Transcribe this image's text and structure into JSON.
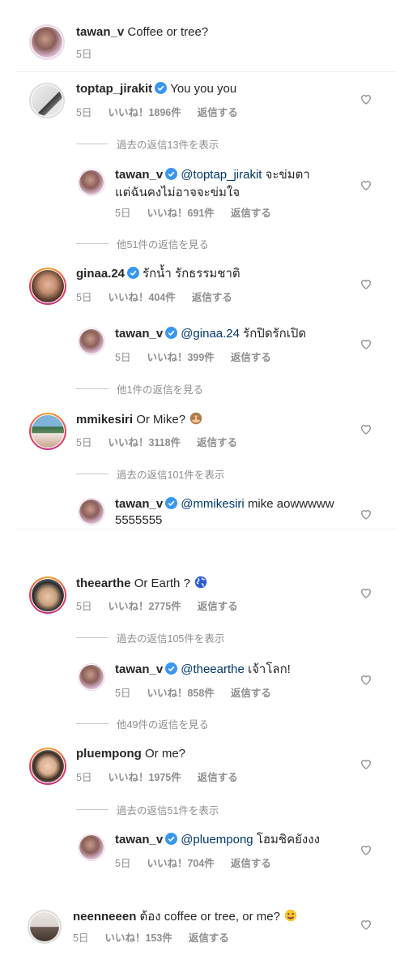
{
  "header_comment": {
    "username": "tawan_v",
    "text": "Coffee or tree?",
    "time": "5日"
  },
  "comments": [
    {
      "username": "toptap_jirakit",
      "text": "You you you",
      "time": "5日",
      "likes": "いいね！1896件",
      "reply": "返信する"
    },
    {
      "view_replies": "過去の返信13件を表示"
    },
    {
      "username": "tawan_v",
      "mention": "@toptap_jirakit",
      "text": "จะข่มตา",
      "text2": "แต่ฉันคงไม่อาจจะข่มใจ",
      "time": "5日",
      "likes": "いいね！691件",
      "reply": "返信する"
    },
    {
      "view_replies": "他51件の返信を見る"
    },
    {
      "username": "ginaa.24",
      "text": "รักน้ำ รักธรรมชาติ",
      "time": "5日",
      "likes": "いいね！404件",
      "reply": "返信する"
    },
    {
      "username": "tawan_v",
      "mention": "@ginaa.24",
      "text": "รักปิดรักเปิด",
      "time": "5日",
      "likes": "いいね！399件",
      "reply": "返信する"
    },
    {
      "view_replies": "他1件の返信を見る"
    },
    {
      "username": "mmikesiri",
      "text": "Or Mike?",
      "time": "5日",
      "likes": "いいね！3118件",
      "reply": "返信する",
      "emoji": "see-no-evil-monkey"
    },
    {
      "view_replies": "過去の返信101件を表示"
    },
    {
      "username": "tawan_v",
      "mention": "@mmikesiri",
      "text": "mike aowwwww",
      "text2": "5555555"
    },
    {
      "username": "theearthe",
      "text": "Or Earth ?",
      "time": "5日",
      "likes": "いいね！2775件",
      "reply": "返信する",
      "emoji": "globe"
    },
    {
      "view_replies": "過去の返信105件を表示"
    },
    {
      "username": "tawan_v",
      "mention": "@theearthe",
      "text": "เจ้าโลก!",
      "time": "5日",
      "likes": "いいね！858件",
      "reply": "返信する"
    },
    {
      "view_replies": "他49件の返信を見る"
    },
    {
      "username": "pluempong",
      "text": "Or me?",
      "time": "5日",
      "likes": "いいね！1975件",
      "reply": "返信する"
    },
    {
      "view_replies": "過去の返信51件を表示"
    },
    {
      "username": "tawan_v",
      "mention": "@pluempong",
      "text": "โฮมชิคยังงง",
      "time": "5日",
      "likes": "いいね！704件",
      "reply": "返信する"
    },
    {
      "username": "neenneeen",
      "text": "ต้อง coffee or tree, or me?",
      "time": "5日",
      "likes": "いいね！153件",
      "reply": "返信する",
      "emoji": "smiling-face"
    }
  ],
  "colors": {
    "verified": "#3897f0",
    "mention": "#00376b",
    "muted": "#8e8e8e"
  }
}
